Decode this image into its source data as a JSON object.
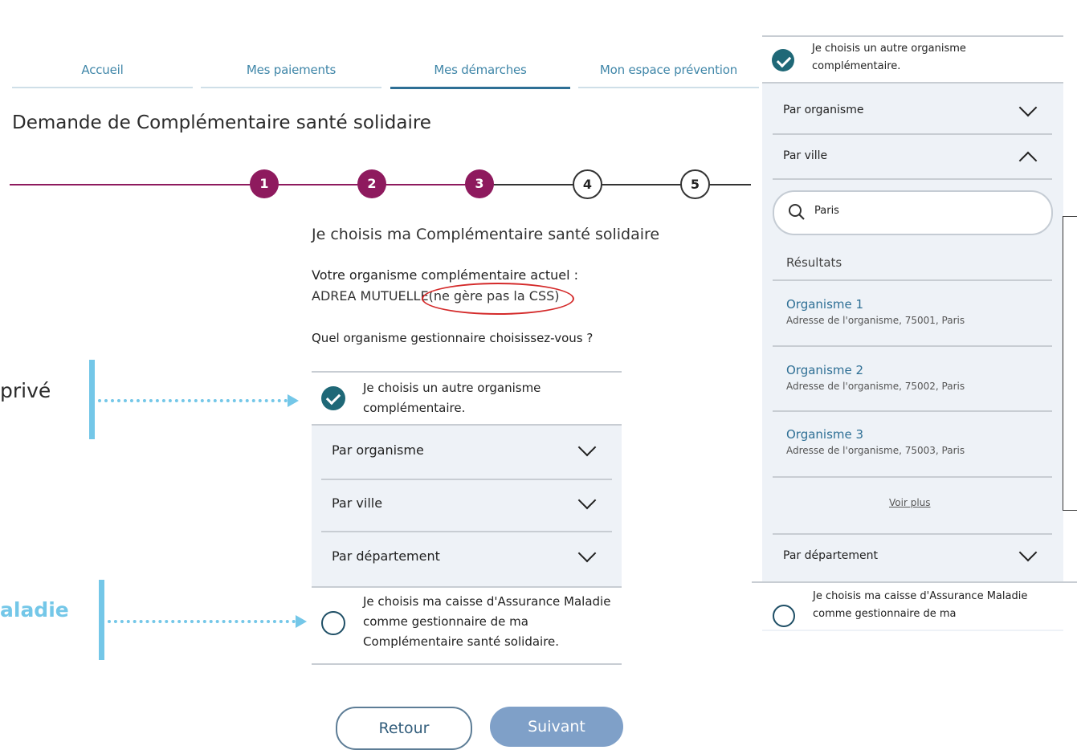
{
  "nav": {
    "tabs": [
      {
        "label": "Accueil"
      },
      {
        "label": "Mes paiements"
      },
      {
        "label": "Mes démarches"
      },
      {
        "label": "Mon espace prévention"
      }
    ]
  },
  "page": {
    "title": "Demande de Complémentaire santé solidaire"
  },
  "stepper": {
    "steps": [
      "1",
      "2",
      "3",
      "4",
      "5"
    ],
    "current_step": 3,
    "accent_color": "#8e1a5e"
  },
  "form": {
    "section_title": "Je choisis ma Complémentaire santé solidaire",
    "current_org_label": "Votre organisme complémentaire actuel :",
    "current_org_value": "ADREA MUTUELLE",
    "current_org_note": "(ne gère pas la CSS)",
    "question": "Quel organisme gestionnaire choisissez-vous ?",
    "option_other_line1": "Je choisis un autre organisme",
    "option_other_line2": "complémentaire.",
    "accordion": [
      {
        "label": "Par organisme"
      },
      {
        "label": "Par ville"
      },
      {
        "label": "Par département"
      }
    ],
    "option_cpam_line1": "Je choisis ma caisse d'Assurance Maladie",
    "option_cpam_line2": "comme gestionnaire de ma",
    "option_cpam_line3": "Complémentaire santé solidaire.",
    "back_label": "Retour",
    "next_label": "Suivant"
  },
  "annotations": {
    "prive": "privé",
    "maladie": "aladie"
  },
  "panel": {
    "option_other_line1": "Je choisis un autre organisme",
    "option_other_line2": "complémentaire.",
    "by_org": "Par organisme",
    "by_city": "Par ville",
    "search_value": "Paris",
    "results_label": "Résultats",
    "results": [
      {
        "name": "Organisme 1",
        "address": "Adresse de l'organisme, 75001, Paris"
      },
      {
        "name": "Organisme 2",
        "address": "Adresse de l'organisme, 75002, Paris"
      },
      {
        "name": "Organisme 3",
        "address": "Adresse de l'organisme, 75003, Paris"
      }
    ],
    "see_more": "Voir plus",
    "by_department": "Par département",
    "option_cpam_line1": "Je choisis ma caisse d'Assurance Maladie",
    "option_cpam_line2": "comme gestionnaire de ma"
  }
}
